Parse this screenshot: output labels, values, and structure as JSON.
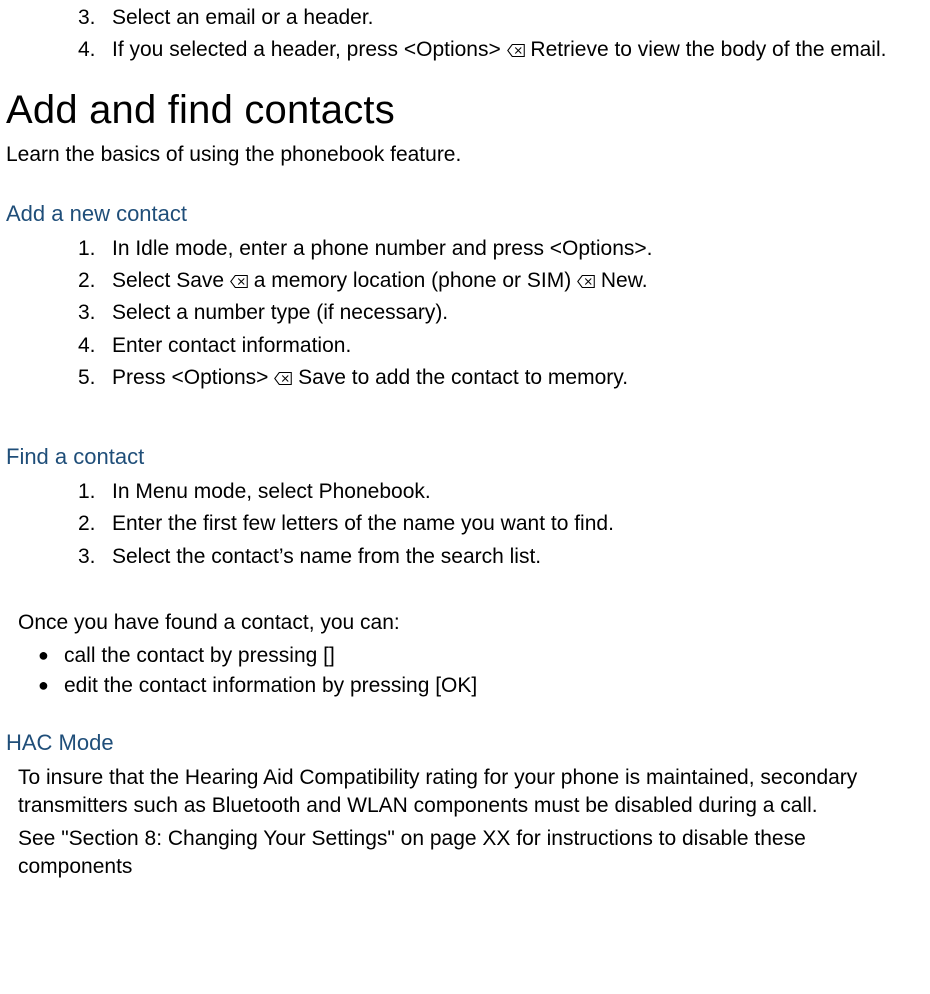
{
  "icon_glyph": "⌫",
  "top_list": [
    {
      "n": "3.",
      "t": "Select an email or a header."
    },
    {
      "n": "4.",
      "parts": [
        "If you selected a header, press <Options> ",
        "{icon}",
        " Retrieve to view the body of the email."
      ]
    }
  ],
  "h1": "Add and find contacts",
  "lead": "Learn the basics of using the phonebook feature.",
  "sec1": {
    "title": "Add a new contact",
    "items": [
      {
        "n": "1.",
        "parts": [
          "In Idle mode, enter a phone number and press <Options>."
        ]
      },
      {
        "n": "2.",
        "parts": [
          "Select Save ",
          "{icon}",
          " a memory location (phone or SIM) ",
          "{icon}",
          " New."
        ]
      },
      {
        "n": "3.",
        "parts": [
          "Select a number type (if necessary)."
        ]
      },
      {
        "n": "4.",
        "parts": [
          "Enter contact information."
        ]
      },
      {
        "n": "5.",
        "parts": [
          "Press <Options> ",
          "{icon}",
          " Save to add the contact to memory."
        ]
      }
    ]
  },
  "sec2": {
    "title": "Find a contact",
    "items": [
      {
        "n": "1.",
        "parts": [
          "In Menu mode, select Phonebook."
        ]
      },
      {
        "n": "2.",
        "parts": [
          "Enter the first few letters of the name you want to find."
        ]
      },
      {
        "n": "3.",
        "parts": [
          "Select the contact’s name from the search list."
        ]
      }
    ]
  },
  "after_find_intro": "Once you have found a contact, you can:",
  "after_find_bullets": [
    "call the contact by pressing []",
    "edit the contact information by pressing [OK]"
  ],
  "sec3": {
    "title": "HAC Mode",
    "p1": "To insure that the Hearing Aid Compatibility rating for your phone is maintained, secondary transmitters such as Bluetooth and WLAN components must be disabled during a call.",
    "p2": "See \"Section 8: Changing Your Settings\" on page XX for instructions to disable these components"
  }
}
